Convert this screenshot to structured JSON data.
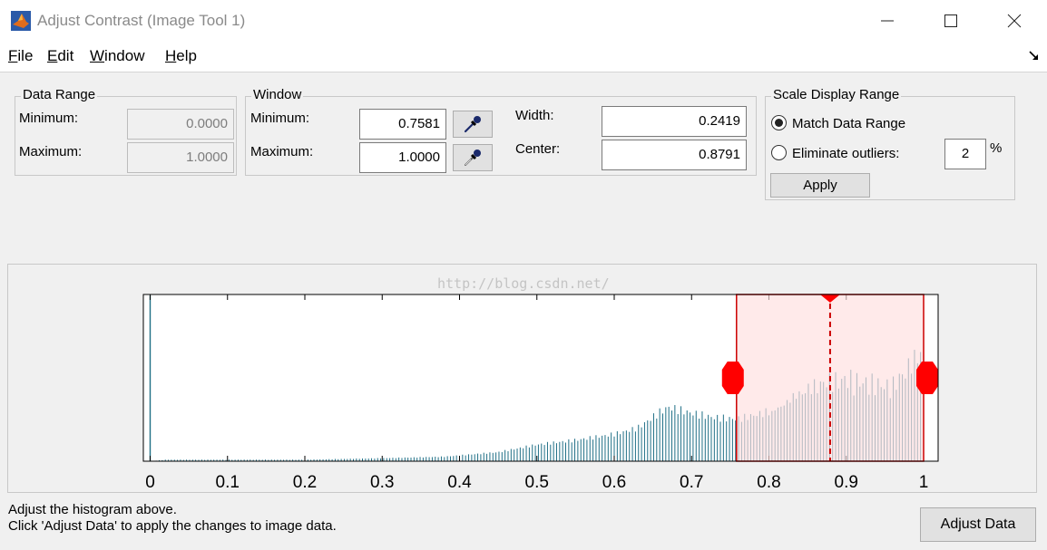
{
  "window": {
    "title": "Adjust Contrast (Image Tool 1)",
    "app_icon": "matlab-icon",
    "controls": [
      "minimize-icon",
      "maximize-icon",
      "close-icon"
    ]
  },
  "menu": {
    "items": [
      {
        "mnemonic": "F",
        "rest": "ile"
      },
      {
        "mnemonic": "E",
        "rest": "dit"
      },
      {
        "mnemonic": "W",
        "rest": "indow"
      },
      {
        "mnemonic": "H",
        "rest": "elp"
      }
    ],
    "dock_icon": "dock-arrow-icon"
  },
  "data_range": {
    "title": "Data Range",
    "min_label": "Minimum:",
    "min_value": "0.0000",
    "max_label": "Maximum:",
    "max_value": "1.0000"
  },
  "window_group": {
    "title": "Window",
    "min_label": "Minimum:",
    "min_value": "0.7581",
    "max_label": "Maximum:",
    "max_value": "1.0000",
    "width_label": "Width:",
    "width_value": "0.2419",
    "center_label": "Center:",
    "center_value": "0.8791",
    "eyedropper_icon": "eyedropper-icon"
  },
  "scale_display": {
    "title": "Scale Display Range",
    "option_match": "Match Data Range",
    "option_eliminate": "Eliminate outliers:",
    "selected": "match",
    "outlier_value": "2",
    "percent_sign": "%",
    "apply_label": "Apply"
  },
  "watermark": "http://blog.csdn.net/",
  "status": {
    "line1": "Adjust the histogram above.",
    "line2": "Click 'Adjust Data' to apply the changes to image data."
  },
  "adjust_button": "Adjust Data",
  "colors": {
    "histogram_bar": "#1f6f86",
    "window_fill": "#ffdede",
    "window_edge": "#cc0000",
    "handle": "#ff0000"
  },
  "chart_data": {
    "type": "bar",
    "xlim": [
      0,
      1
    ],
    "x_ticks": [
      "0",
      "0.1",
      "0.2",
      "0.3",
      "0.4",
      "0.5",
      "0.6",
      "0.7",
      "0.8",
      "0.9",
      "1"
    ],
    "window_min": 0.7581,
    "window_max": 1.0,
    "window_center": 0.8791,
    "spike_at_zero": 1.0,
    "profile": [
      [
        0.0,
        0.0
      ],
      [
        0.02,
        0.01
      ],
      [
        0.1,
        0.01
      ],
      [
        0.2,
        0.01
      ],
      [
        0.3,
        0.02
      ],
      [
        0.38,
        0.03
      ],
      [
        0.45,
        0.06
      ],
      [
        0.5,
        0.11
      ],
      [
        0.55,
        0.14
      ],
      [
        0.6,
        0.18
      ],
      [
        0.63,
        0.22
      ],
      [
        0.66,
        0.33
      ],
      [
        0.67,
        0.36
      ],
      [
        0.7,
        0.32
      ],
      [
        0.73,
        0.29
      ],
      [
        0.76,
        0.28
      ],
      [
        0.8,
        0.33
      ],
      [
        0.84,
        0.48
      ],
      [
        0.87,
        0.55
      ],
      [
        0.9,
        0.57
      ],
      [
        0.93,
        0.54
      ],
      [
        0.96,
        0.52
      ],
      [
        0.98,
        0.66
      ],
      [
        1.0,
        0.78
      ]
    ]
  }
}
